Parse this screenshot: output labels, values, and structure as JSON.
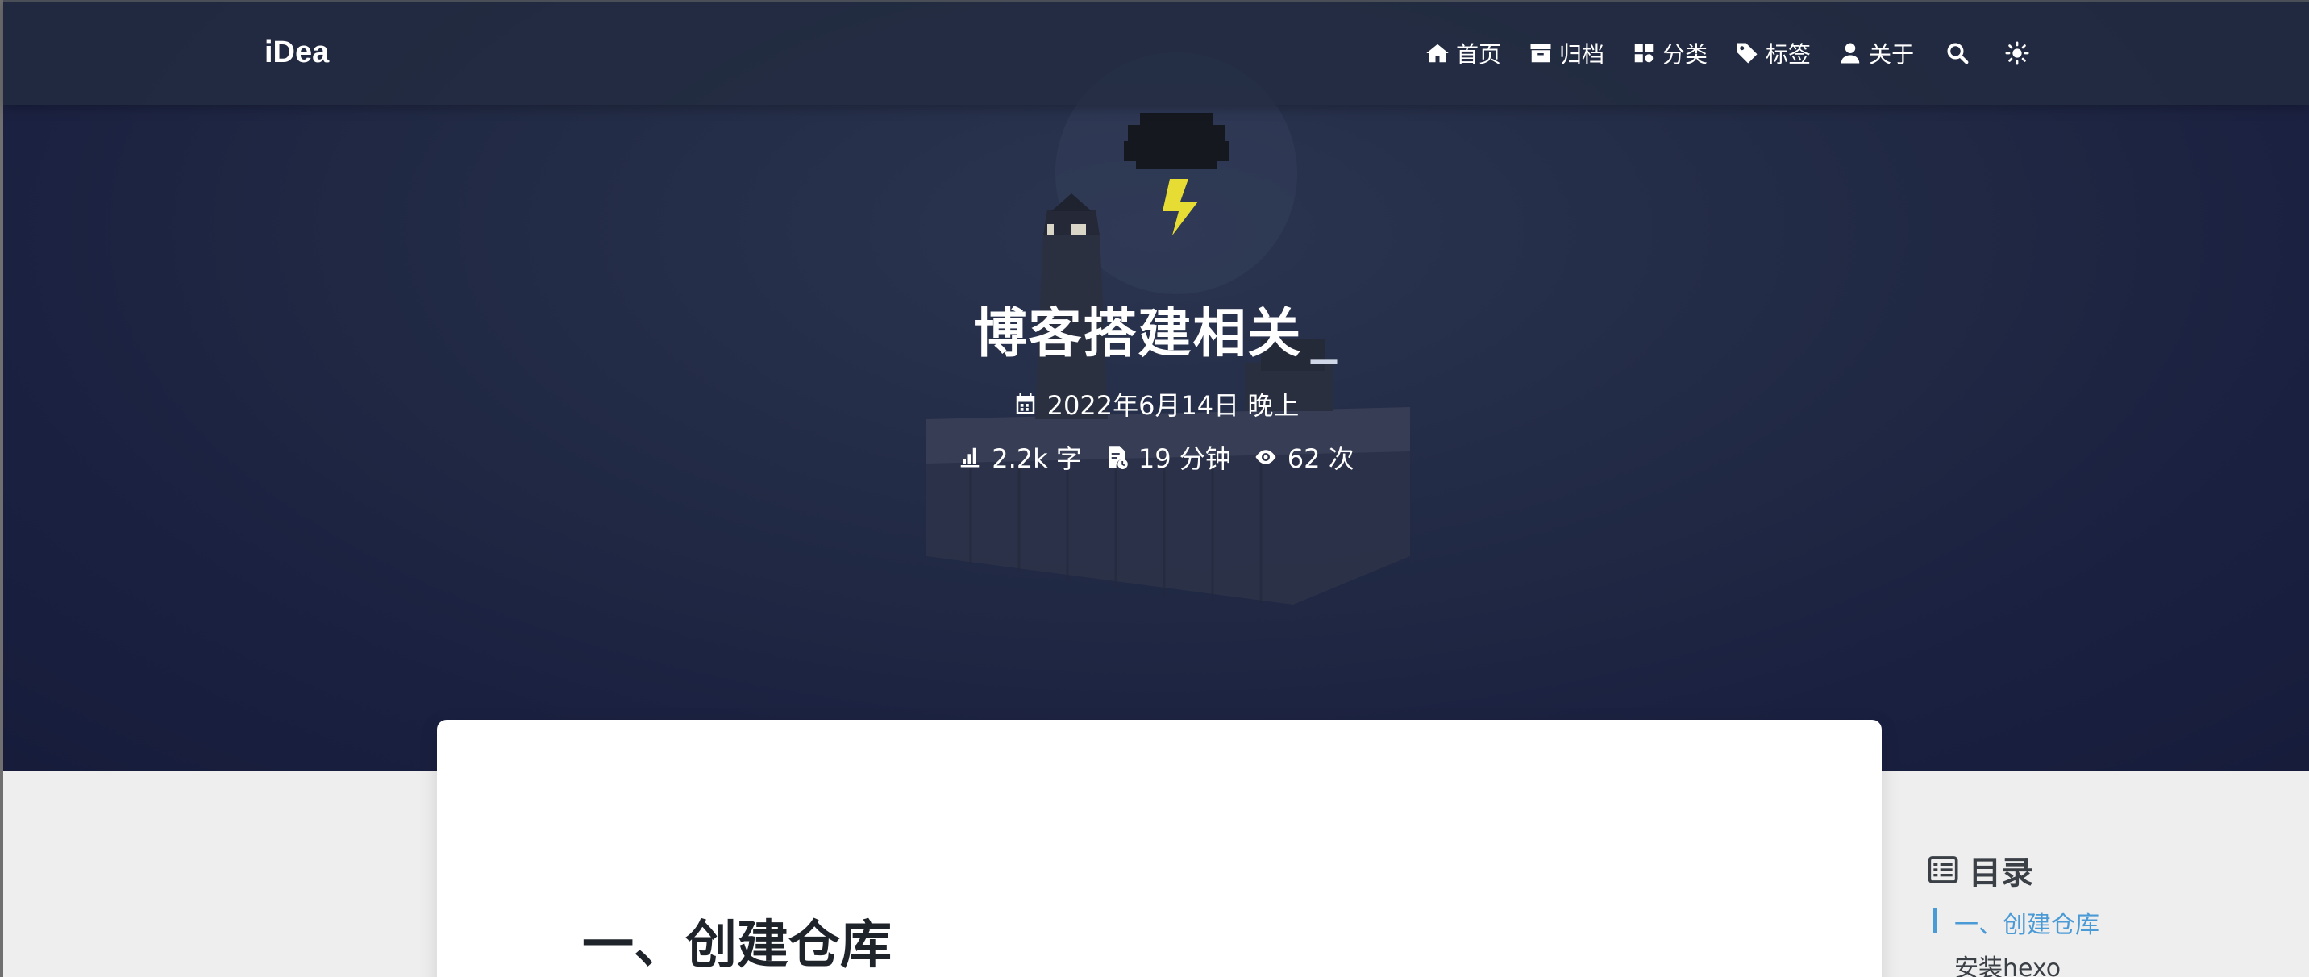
{
  "navbar": {
    "brand": "iDea",
    "items": [
      {
        "label": "首页",
        "icon": "home-icon"
      },
      {
        "label": "归档",
        "icon": "archive-icon"
      },
      {
        "label": "分类",
        "icon": "category-icon"
      },
      {
        "label": "标签",
        "icon": "tag-icon"
      },
      {
        "label": "关于",
        "icon": "user-icon"
      }
    ],
    "search_icon": "search-icon",
    "theme_icon": "sun-icon"
  },
  "post": {
    "title": "博客搭建相关",
    "cursor": "_",
    "date": "2022年6月14日 晚上",
    "words": "2.2k 字",
    "read_time": "19 分钟",
    "views": "62 次"
  },
  "article": {
    "heading": "一、创建仓库"
  },
  "toc": {
    "title": "目录",
    "items": [
      {
        "label": "一、创建仓库",
        "active": true
      },
      {
        "label": "安装hexo",
        "active": false
      }
    ]
  },
  "colors": {
    "accent": "#4a9ad6",
    "hero_bg": "#1e2642",
    "bolt": "#e6dc33"
  }
}
